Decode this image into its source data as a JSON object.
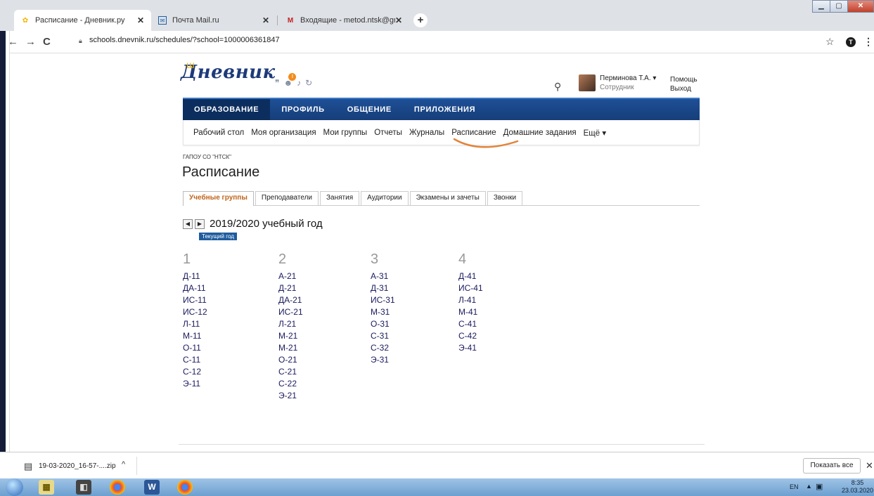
{
  "browser": {
    "tabs": [
      {
        "title": "Расписание - Дневник.ру",
        "active": true
      },
      {
        "title": "Почта Mail.ru",
        "active": false
      },
      {
        "title": "Входящие - metod.ntsk@gmail.c",
        "active": false
      }
    ],
    "new_tab": "+",
    "url": "schools.dnevnik.ru/schedules/?school=1000006361847",
    "profile_initial": "T"
  },
  "site": {
    "logo": "Дневник",
    "user_name": "Перминова Т.А. ▾",
    "user_role": "Сотрудник",
    "help": "Помощь",
    "logout": "Выход",
    "main_nav": [
      "ОБРАЗОВАНИЕ",
      "ПРОФИЛЬ",
      "ОБЩЕНИЕ",
      "ПРИЛОЖЕНИЯ"
    ],
    "sub_nav": [
      "Рабочий стол",
      "Моя организация",
      "Мои группы",
      "Отчеты",
      "Журналы",
      "Расписание",
      "Домашние задания",
      "Ещё ▾"
    ],
    "breadcrumb": "ГАПОУ СО \"НТСК\"",
    "page_title": "Расписание",
    "tabs": [
      "Учебные группы",
      "Преподаватели",
      "Занятия",
      "Аудитории",
      "Экзамены и зачеты",
      "Звонки"
    ],
    "year": "2019/2020 учебный год",
    "current_year_badge": "Текущий год",
    "courses": [
      {
        "num": "1",
        "groups": [
          "Д-11",
          "ДА-11",
          "ИС-11",
          "ИС-12",
          "Л-11",
          "М-11",
          "О-11",
          "С-11",
          "С-12",
          "Э-11"
        ]
      },
      {
        "num": "2",
        "groups": [
          "А-21",
          "Д-21",
          "ДА-21",
          "ИС-21",
          "Л-21",
          "М-21",
          "М-21",
          "О-21",
          "С-21",
          "С-22",
          "Э-21"
        ]
      },
      {
        "num": "3",
        "groups": [
          "А-31",
          "Д-31",
          "ИС-31",
          "М-31",
          "О-31",
          "С-31",
          "С-32",
          "Э-31"
        ]
      },
      {
        "num": "4",
        "groups": [
          "Д-41",
          "ИС-41",
          "Л-41",
          "М-41",
          "С-41",
          "С-42",
          "Э-41"
        ]
      }
    ]
  },
  "downloads": {
    "file": "19-03-2020_16-57-....zip",
    "show_all": "Показать все"
  },
  "taskbar": {
    "lang": "EN",
    "time": "8:35",
    "date": "23.03.2020"
  }
}
